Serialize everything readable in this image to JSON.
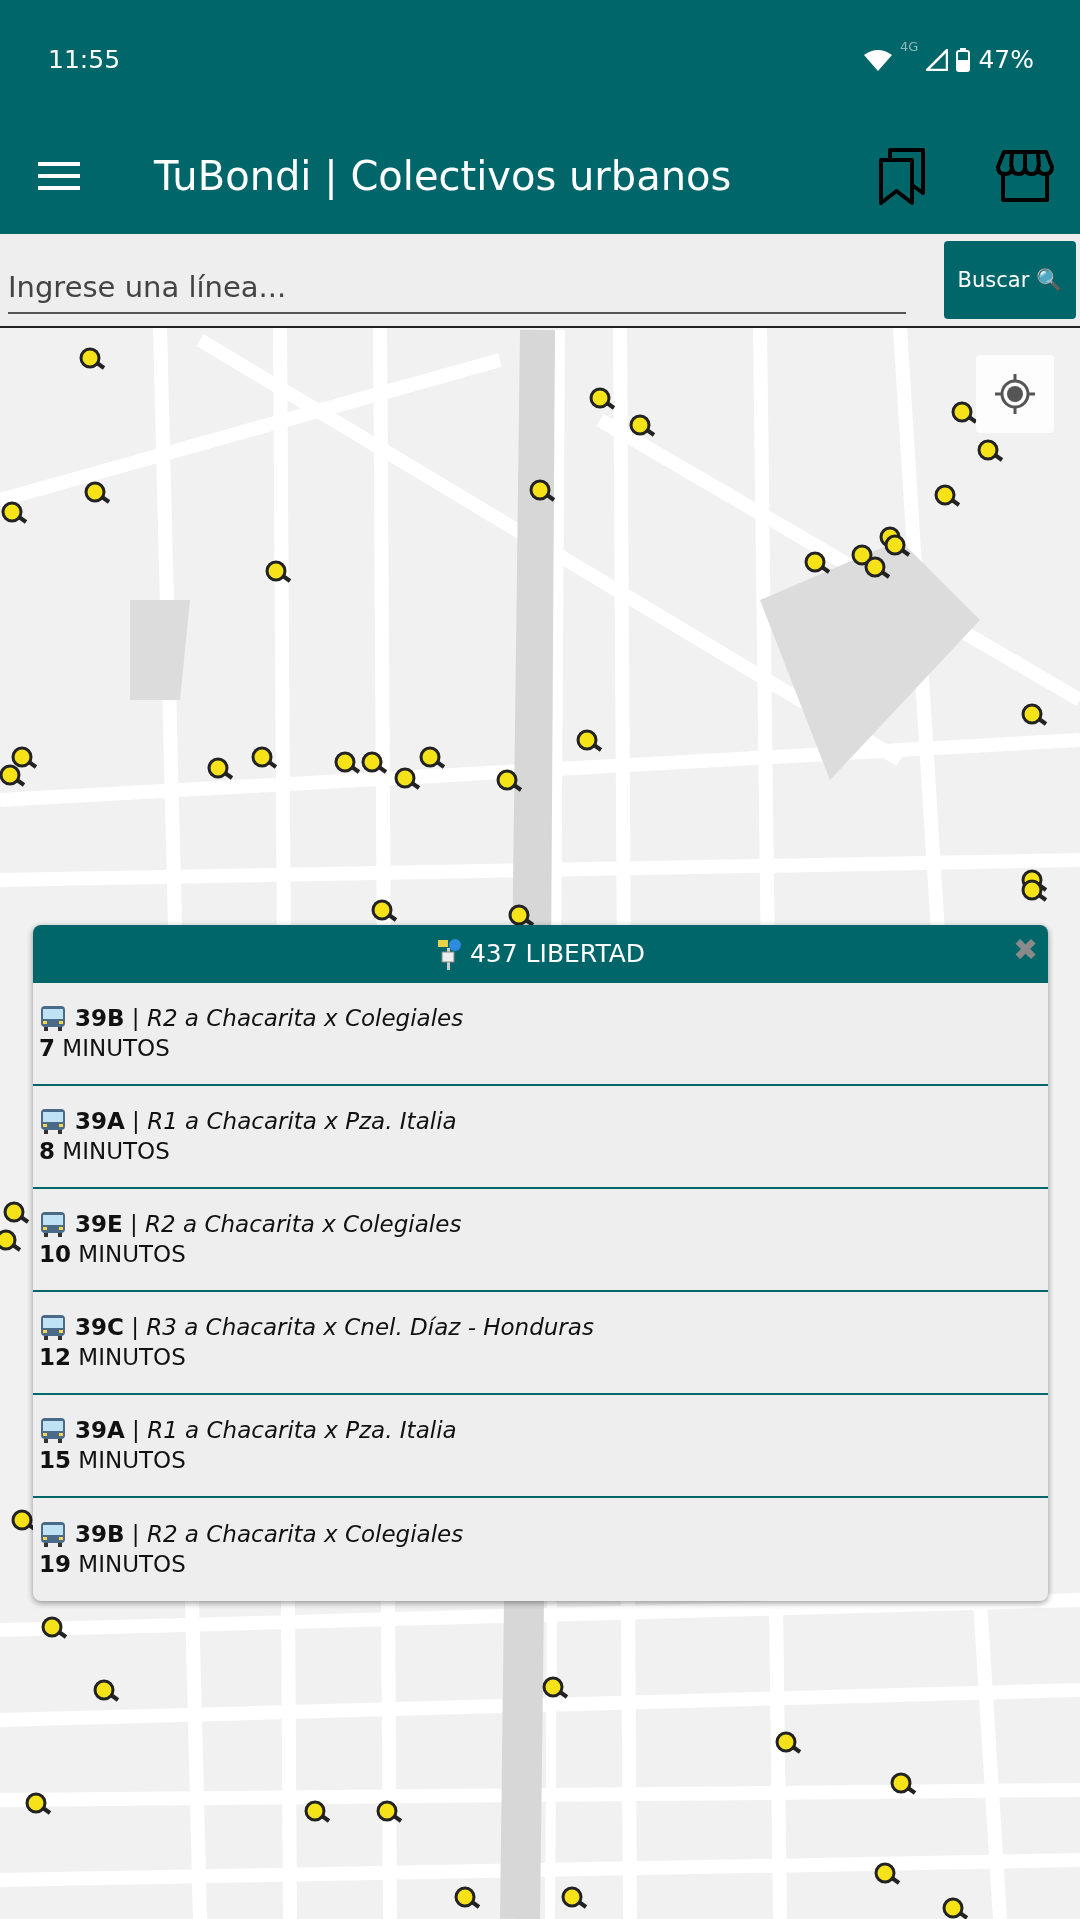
{
  "status_bar": {
    "time": "11:55",
    "network": "4G",
    "battery": "47%"
  },
  "app_bar": {
    "title": "TuBondi | Colectivos urbanos"
  },
  "search": {
    "placeholder": "Ingrese una línea...",
    "button": "Buscar 🔍"
  },
  "stop_popup": {
    "title": "437 LIBERTAD",
    "close": "✖",
    "arrivals": [
      {
        "line": "**39B** | *R2 a Chacarita x Colegiales*",
        "eta": "**7** MINUTOS"
      },
      {
        "line": "**39A** | *R1 a Chacarita x Pza. Italia*",
        "eta": "**8** MINUTOS"
      },
      {
        "line": "**39E** | *R2 a Chacarita x Colegiales*",
        "eta": "**10** MINUTOS"
      },
      {
        "line": "**39C** | *R3 a Chacarita x Cnel. Díaz - Honduras*",
        "eta": "**12** MINUTOS"
      },
      {
        "line": "**39A** | *R1 a Chacarita x Pza. Italia*",
        "eta": "**15** MINUTOS"
      },
      {
        "line": "**39B** | *R2 a Chacarita x Colegiales*",
        "eta": "**19** MINUTOS"
      }
    ]
  }
}
